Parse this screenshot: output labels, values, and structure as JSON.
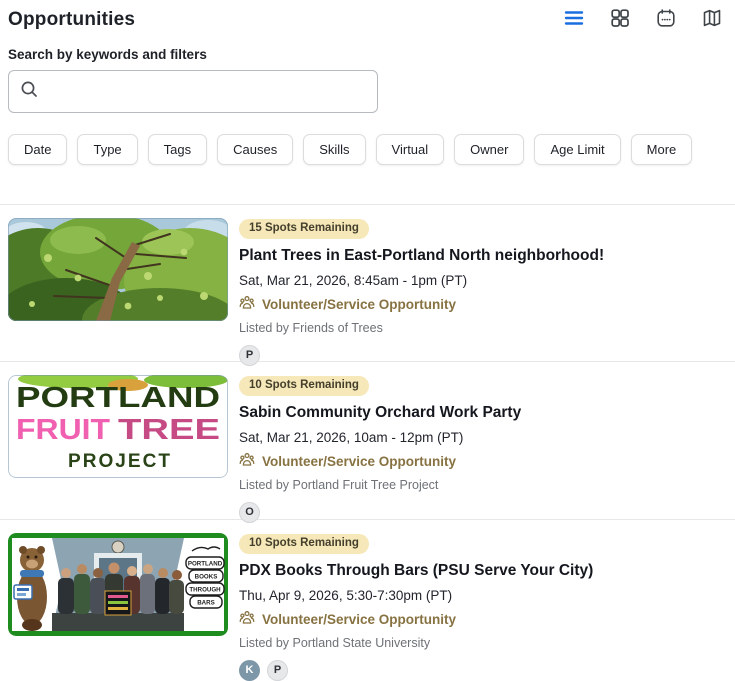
{
  "header": {
    "title": "Opportunities",
    "view_buttons": [
      {
        "name": "list-view",
        "icon": "hamburger-icon",
        "active": true
      },
      {
        "name": "grid-view",
        "icon": "grid-icon",
        "active": false
      },
      {
        "name": "calendar-view",
        "icon": "calendar-icon",
        "active": false
      },
      {
        "name": "map-view",
        "icon": "map-icon",
        "active": false
      }
    ]
  },
  "search": {
    "label": "Search by keywords and filters",
    "value": "",
    "placeholder": "",
    "icon": "search-icon"
  },
  "filters": {
    "labels": [
      "Date",
      "Type",
      "Tags",
      "Causes",
      "Skills",
      "Virtual",
      "Owner",
      "Age Limit",
      "More"
    ]
  },
  "colors": {
    "accent_blue": "#1a6fe0",
    "badge_bg": "#f6e8b8",
    "badge_text": "#45402d",
    "type_text": "#877242",
    "muted_text": "#6e7277",
    "divider": "#e7e7e8"
  },
  "cards": [
    {
      "badge": "15 Spots Remaining",
      "title": "Plant Trees in East-Portland North neighborhood!",
      "datetime": "Sat, Mar 21, 2026, 8:45am - 1pm (PT)",
      "type_label": "Volunteer/Service Opportunity",
      "type_icon": "people-group-icon",
      "listed_by": "Listed by Friends of Trees",
      "image": "tree-canopy-photo",
      "avatars": [
        {
          "initial": "P",
          "variant": "light"
        }
      ]
    },
    {
      "badge": "10 Spots Remaining",
      "title": "Sabin Community Orchard Work Party",
      "datetime": "Sat, Mar 21, 2026, 10am - 12pm (PT)",
      "type_label": "Volunteer/Service Opportunity",
      "type_icon": "people-group-icon",
      "listed_by": "Listed by Portland Fruit Tree Project",
      "image": "portland-fruit-tree-project-logo",
      "image_words": [
        "PORTLAND",
        "FRUIT",
        "TREE",
        "PROJECT"
      ],
      "avatars": [
        {
          "initial": "O",
          "variant": "light"
        }
      ]
    },
    {
      "badge": "10 Spots Remaining",
      "title": "PDX Books Through Bars (PSU Serve Your City)",
      "datetime": "Thu, Apr 9, 2026, 5:30-7:30pm (PT)",
      "type_label": "Volunteer/Service Opportunity",
      "type_icon": "people-group-icon",
      "listed_by": "Listed by Portland State University",
      "image": "books-through-bars-photo",
      "book_labels": [
        "PORTLAND",
        "BOOKS",
        "THROUGH",
        "BARS"
      ],
      "avatars": [
        {
          "initial": "K",
          "variant": "dark"
        },
        {
          "initial": "P",
          "variant": "light"
        }
      ]
    }
  ]
}
